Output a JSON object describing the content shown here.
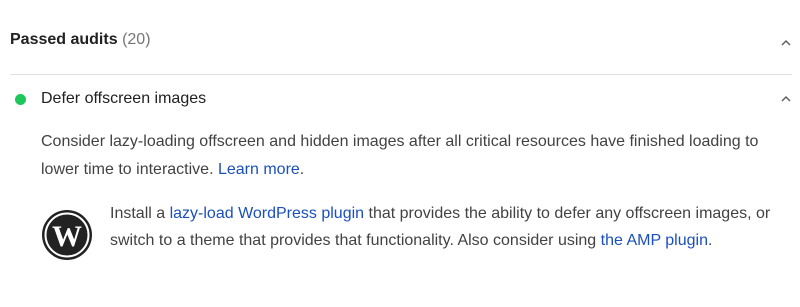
{
  "section": {
    "title": "Passed audits",
    "count": "(20)"
  },
  "audit": {
    "title": "Defer offscreen images",
    "status_color": "#1fc65b",
    "description": "Consider lazy-loading offscreen and hidden images after all critical resources have finished loading to lower time to interactive.",
    "learn_more": "Learn more",
    "learn_more_suffix": "."
  },
  "wordpress_tip": {
    "icon": "wordpress-logo-icon",
    "text_before": "Install a",
    "link1": "lazy-load WordPress plugin",
    "text_middle": "that provides the ability to defer any offscreen images, or switch to a theme that provides that functionality. Also consider using",
    "link2": "the AMP plugin",
    "text_end": "."
  },
  "colors": {
    "link": "#1a4fbe",
    "pass": "#1fc65b",
    "divider": "#e0e0e0"
  }
}
